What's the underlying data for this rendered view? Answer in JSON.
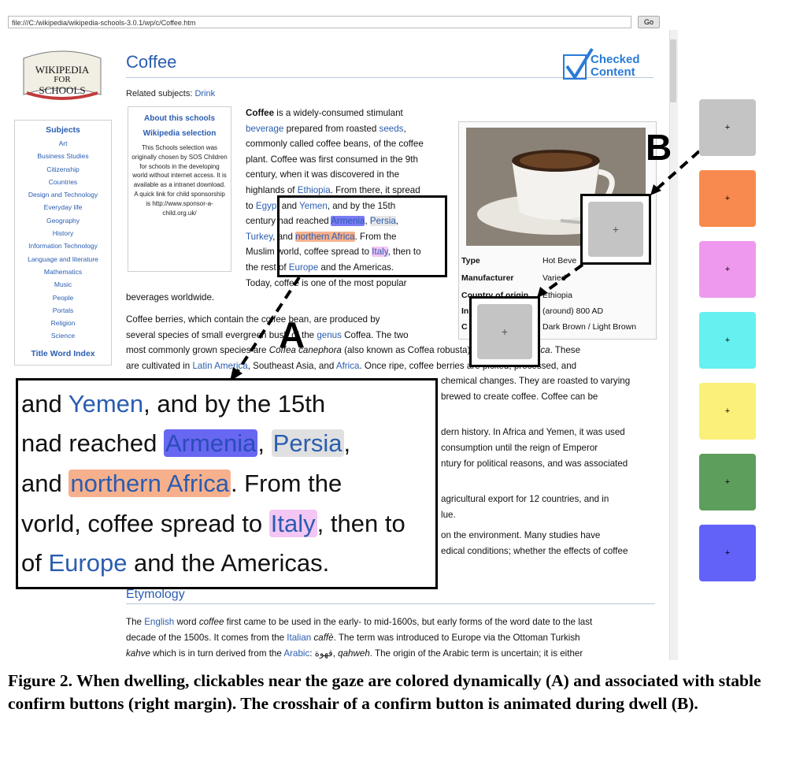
{
  "browser": {
    "address": "file:///C:/wikipedia/wikipedia-schools-3.0.1/wp/c/Coffee.htm",
    "go_label": "Go"
  },
  "logo": {
    "line1": "WIKIPEDIA",
    "line2": "FOR",
    "line3": "SCHOOLS"
  },
  "sidebar": {
    "heading": "Subjects",
    "items": [
      "Art",
      "Business Studies",
      "Citizenship",
      "Countries",
      "Design and Technology",
      "Everyday life",
      "Geography",
      "History",
      "Information Technology",
      "Language and literature",
      "Mathematics",
      "Music",
      "People",
      "Portals",
      "Religion",
      "Science"
    ],
    "title_index": "Title Word Index"
  },
  "article": {
    "title": "Coffee",
    "checked_line1": "Checked",
    "checked_line2": "Content",
    "related_label": "Related subjects:",
    "related_link": "Drink"
  },
  "about": {
    "heading1": "About this schools",
    "heading2": "Wikipedia selection",
    "body": "This Schools selection was originally chosen by SOS Children for schools in the developing world without internet access. It is available as a intranet download. A quick link for child sponsorship is http://www.sponsor-a-child.org.uk/"
  },
  "intro": {
    "bold": "Coffee",
    "l1": " is a widely-consumed stimulant",
    "l2_link": "beverage",
    "l2a": " prepared from roasted ",
    "l2_link2": "seeds",
    "l2b": ",",
    "l3": "commonly called coffee beans, of the coffee",
    "l4": "plant. Coffee was first consumed in the 9th",
    "l5": "century, when it was discovered in the",
    "l6a": "highlands of ",
    "l6_link": "Ethiopia",
    "l6b": ". From there, it spread",
    "l7a": "to ",
    "l7_link": "Egypt",
    "l7b": " and ",
    "l7_link2": "Yemen",
    "l7c": ", and by the 15th",
    "l8a": "century ",
    "l8b": "had reached ",
    "l8_link": "Armenia",
    "l8c": ", ",
    "l8_link2": "Persia",
    "l8d": ",",
    "l9_link": "Turkey",
    "l9a": ", and ",
    "l9_link2": "northern Africa",
    "l9b": ". From the",
    "l10a": "Muslim world, coffee spread to ",
    "l10_link": "Italy",
    "l10b": ", then to",
    "l11a": "the rest of ",
    "l11_link": "Europe",
    "l11b": " and the Americas.",
    "l12": "Today, coffee is one of the most popular",
    "l13": "beverages worldwide."
  },
  "para2": {
    "l1": "Coffee berries, which contain the coffee bean, are produced by",
    "l2a": "several species of small evergreen bush of the ",
    "l2_link": "genus",
    "l2b": " Coffea. The two",
    "l3a": "most commonly grown species are ",
    "l3b": "Coffea canephora",
    "l3c": " (also known as Coffea robusta) and ",
    "l3d": "Coffea arabica",
    "l3e": ". These",
    "l4a": "are cultivated in ",
    "l4_link": "Latin America",
    "l4b": ", Southeast Asia, and ",
    "l4_link2": "Africa",
    "l4c": ". Once ripe, coffee berries are picked, processed, and",
    "l5": "chemical changes. They are roasted to varying",
    "l6": "brewed to create coffee. Coffee can be",
    "l7": "dern history. In Africa and Yemen, it was used",
    "l8": "consumption until the reign of Emperor",
    "l9": "ntury for political reasons, and was associated",
    "l10": "agricultural export for 12 countries, and in",
    "l11": "lue.",
    "l12": "on the environment. Many studies have",
    "l13": "edical conditions; whether the effects of coffee"
  },
  "infobox": {
    "rows": [
      {
        "label": "Type",
        "value": "Hot Beve"
      },
      {
        "label": "Manufacturer",
        "value": "Varied"
      },
      {
        "label": "Country of origin",
        "value": "Ethiopia"
      },
      {
        "label": "In",
        "value": "(around) 800 AD"
      },
      {
        "label": "C",
        "value": "Dark Brown / Light Brown"
      }
    ]
  },
  "etymology": {
    "heading": "Etymology",
    "l1a": "The ",
    "l1_link": "English",
    "l1b": " word ",
    "l1c": "coffee",
    "l1d": " first came to be used in the early- to mid-1600s, but early forms of the word date to the last",
    "l2a": "decade of the 1500s. It comes from the ",
    "l2_link": "Italian",
    "l2b": " ",
    "l2c": "caffè",
    "l2d": ". The term was introduced to Europe via the Ottoman Turkish",
    "l3a": "kahve",
    "l3b": " which is in turn derived from the ",
    "l3_link": "Arabic",
    "l3c": ": قهوة, ",
    "l3d": "qahweh",
    "l3e": ". The origin of the Arabic term is uncertain; it is either"
  },
  "zoom": {
    "l1a": "and ",
    "l1_link": "Yemen",
    "l1b": ", and by the 15th",
    "l2a": "nad reached ",
    "l2_link": "Armenia",
    "l2b": ", ",
    "l2_link2": "Persia",
    "l2c": ",",
    "l3a": "and ",
    "l3_link": "northern Africa",
    "l3b": ". From the",
    "l4a": "vorld, coffee spread to ",
    "l4_link": "Italy",
    "l4b": ", then to",
    "l5a": "of ",
    "l5_link": "Europe",
    "l5b": " and the Americas."
  },
  "labels": {
    "a": "A",
    "b": "B"
  },
  "confirm_buttons": [
    {
      "color": "#c4c4c4"
    },
    {
      "color": "#f98a4f"
    },
    {
      "color": "#ee99ee"
    },
    {
      "color": "#66f0f0"
    },
    {
      "color": "#fbf07a"
    },
    {
      "color": "#5d9e5d"
    },
    {
      "color": "#6262f8"
    }
  ],
  "crosshair": "+",
  "caption": "Figure 2. When dwelling, clickables near the gaze are colored dynamically (A) and associated with stable confirm buttons (right margin). The crosshair of a confirm button is animated during dwell (B)."
}
